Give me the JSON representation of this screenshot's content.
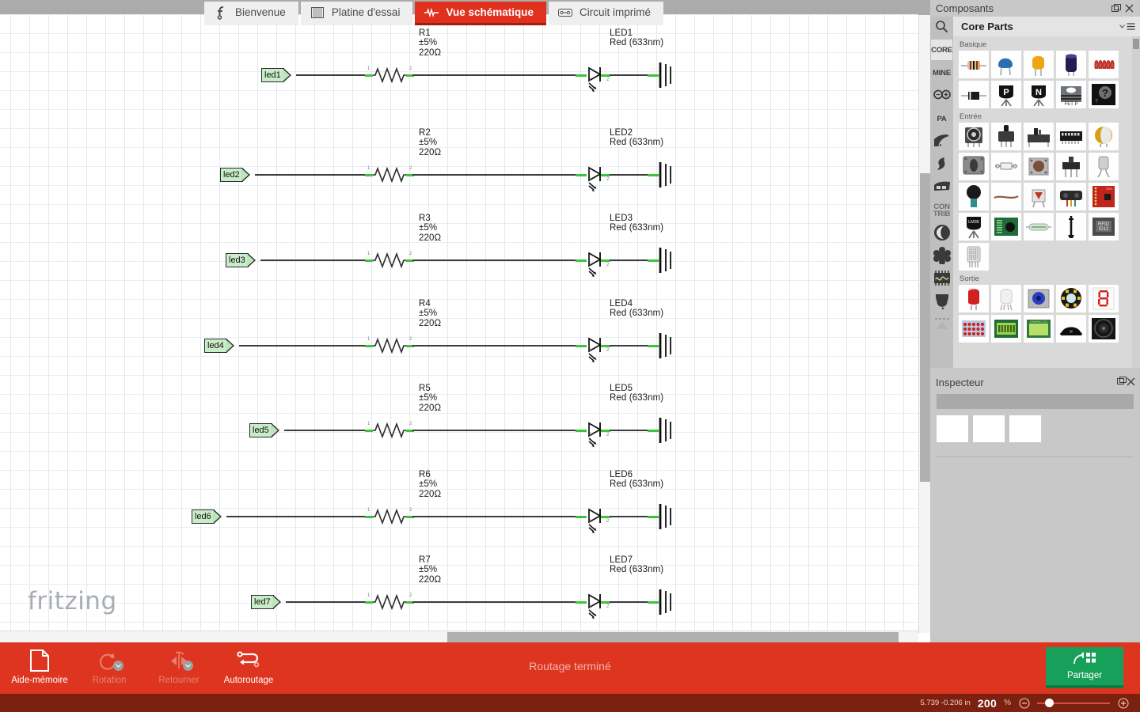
{
  "view_tabs": [
    {
      "label": "Bienvenue",
      "icon": "fritzing-f-icon",
      "active": false
    },
    {
      "label": "Platine d'essai",
      "icon": "breadboard-icon",
      "active": false
    },
    {
      "label": "Vue schématique",
      "icon": "schematic-icon",
      "active": true
    },
    {
      "label": "Circuit imprimé",
      "icon": "pcb-icon",
      "active": false
    }
  ],
  "canvas": {
    "watermark": "fritzing",
    "rows": [
      {
        "net_label": "led1",
        "resistor": {
          "name": "R1",
          "tolerance": "±5%",
          "value": "220Ω"
        },
        "led": {
          "name": "LED1",
          "spec": "Red (633nm)"
        },
        "pin_in": "1",
        "pin_out": "2",
        "led_pin_in": "1",
        "led_pin_out": "2"
      },
      {
        "net_label": "led2",
        "resistor": {
          "name": "R2",
          "tolerance": "±5%",
          "value": "220Ω"
        },
        "led": {
          "name": "LED2",
          "spec": "Red (633nm)"
        },
        "pin_in": "1",
        "pin_out": "2",
        "led_pin_in": "1",
        "led_pin_out": "2"
      },
      {
        "net_label": "led3",
        "resistor": {
          "name": "R3",
          "tolerance": "±5%",
          "value": "220Ω"
        },
        "led": {
          "name": "LED3",
          "spec": "Red (633nm)"
        },
        "pin_in": "1",
        "pin_out": "2",
        "led_pin_in": "1",
        "led_pin_out": "2"
      },
      {
        "net_label": "led4",
        "resistor": {
          "name": "R4",
          "tolerance": "±5%",
          "value": "220Ω"
        },
        "led": {
          "name": "LED4",
          "spec": "Red (633nm)"
        },
        "pin_in": "1",
        "pin_out": "2",
        "led_pin_in": "1",
        "led_pin_out": "2"
      },
      {
        "net_label": "led5",
        "resistor": {
          "name": "R5",
          "tolerance": "±5%",
          "value": "220Ω"
        },
        "led": {
          "name": "LED5",
          "spec": "Red (633nm)"
        },
        "pin_in": "1",
        "pin_out": "2",
        "led_pin_in": "1",
        "led_pin_out": "2"
      },
      {
        "net_label": "led6",
        "resistor": {
          "name": "R6",
          "tolerance": "±5%",
          "value": "220Ω"
        },
        "led": {
          "name": "LED6",
          "spec": "Red (633nm)"
        },
        "pin_in": "1",
        "pin_out": "2",
        "led_pin_in": "1",
        "led_pin_out": "2"
      },
      {
        "net_label": "led7",
        "resistor": {
          "name": "R7",
          "tolerance": "±5%",
          "value": "220Ω"
        },
        "led": {
          "name": "LED7",
          "spec": "Red (633nm)"
        },
        "pin_in": "1",
        "pin_out": "2",
        "led_pin_in": "1",
        "led_pin_out": "2"
      }
    ]
  },
  "parts_panel": {
    "title": "Composants",
    "bin_name": "Core Parts",
    "bin_tabs": [
      {
        "label": "CORE",
        "kind": "text",
        "selected": true
      },
      {
        "label": "MINE",
        "kind": "text",
        "selected": false
      },
      {
        "label": "",
        "kind": "arduino-icon",
        "selected": false
      },
      {
        "label": "PA",
        "kind": "text",
        "selected": false
      },
      {
        "label": "",
        "kind": "sparkfun-icon",
        "selected": false
      },
      {
        "label": "",
        "kind": "snootlab-icon",
        "selected": false
      },
      {
        "label": "",
        "kind": "seeed-icon",
        "selected": false
      },
      {
        "label": "CON TRIB",
        "kind": "text2",
        "selected": false
      },
      {
        "label": "",
        "kind": "moon-icon",
        "selected": false
      },
      {
        "label": "",
        "kind": "gear-flower-icon",
        "selected": false
      },
      {
        "label": "",
        "kind": "chip-wave-icon",
        "selected": false
      },
      {
        "label": "",
        "kind": "connector-icon",
        "selected": false
      },
      {
        "label": "",
        "kind": "scroll-up-icon",
        "selected": false
      }
    ],
    "sections": [
      {
        "label": "Basique",
        "parts": [
          "resistor-icon",
          "ceramic-capacitor-icon",
          "tantalum-capacitor-icon",
          "electrolytic-capacitor-icon",
          "inductor-icon",
          "diode-icon",
          "pnp-transistor-icon",
          "npn-transistor-icon",
          "mosfet-icon",
          "unknown-part-icon"
        ]
      },
      {
        "label": "Entrée",
        "parts": [
          "trimmer-potentiometer-icon",
          "rotary-potentiometer-icon",
          "slide-potentiometer-icon",
          "dip-switch-icon",
          "piezo-sensor-icon",
          "rotary-switch-icon",
          "spdt-switch-icon",
          "pushbutton-icon",
          "slide-switch-icon",
          "tilt-sensor-icon",
          "force-sensor-icon",
          "flex-sensor-icon",
          "photo-sensor-icon",
          "infrared-sensor-icon",
          "sparkfun-breakout-icon",
          "temperature-sensor-icon",
          "sensor-board-icon",
          "reed-switch-icon",
          "antenna-icon",
          "rfid-reader-icon",
          "humidity-sensor-icon"
        ]
      },
      {
        "label": "Sortie",
        "parts": [
          "red-led-icon",
          "rgb-led-icon",
          "blue-led-module-icon",
          "neopixel-ring-icon",
          "seven-segment-display-icon",
          "led-matrix-icon",
          "lcd-display-icon",
          "lcd-graphic-icon",
          "buzzer-icon",
          "speaker-icon"
        ]
      }
    ]
  },
  "inspector": {
    "title": "Inspecteur"
  },
  "bottom_toolbar": {
    "tools": [
      {
        "label": "Aide-mémoire",
        "icon": "notes-page-icon",
        "enabled": true,
        "has_dropdown": false
      },
      {
        "label": "Rotation",
        "icon": "rotate-icon",
        "enabled": false,
        "has_dropdown": true
      },
      {
        "label": "Retourner",
        "icon": "flip-icon",
        "enabled": false,
        "has_dropdown": true
      },
      {
        "label": "Autoroutage",
        "icon": "autoroute-icon",
        "enabled": true,
        "has_dropdown": false
      }
    ],
    "routing_status": "Routage terminé",
    "share_label": "Partager",
    "share_icon": "share-grid-icon"
  },
  "status_bar": {
    "coordinates": "5.739 -0.206 in",
    "zoom_value": "200",
    "zoom_unit": "%",
    "zoom_out_icon": "minus-circle-icon",
    "zoom_in_icon": "plus-circle-icon"
  },
  "colors": {
    "accent_red": "#dd3520",
    "status_bar": "#7c2010",
    "share_green": "#17a05a",
    "wire": "#3c3c3c",
    "connector_green": "#3cc23c",
    "dock_gray": "#c8c8c8"
  }
}
